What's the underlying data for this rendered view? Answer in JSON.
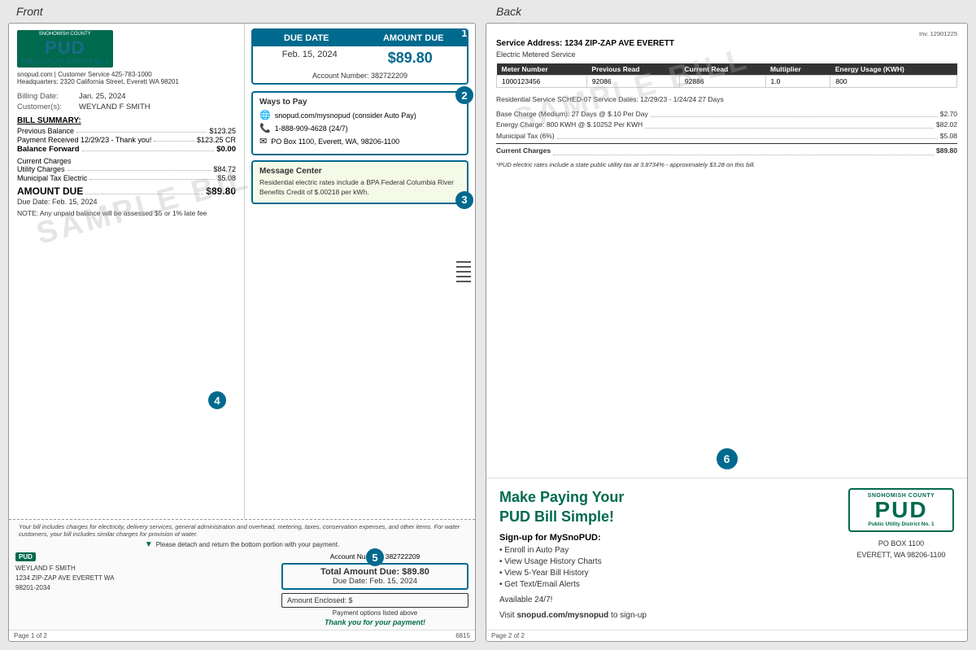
{
  "labels": {
    "front": "Front",
    "back": "Back"
  },
  "front": {
    "pud": {
      "county": "SNOHOMISH COUNTY",
      "name": "PUD",
      "subtitle": "PUBLIC UTILITY DISTRICT NO. 1",
      "contact": "snopud.com | Customer Service 425-783-1000",
      "headquarters": "Headquarters: 2320 California Street, Everett WA 98201"
    },
    "due_date_box": {
      "due_date_label": "DUE DATE",
      "amount_due_label": "AMOUNT DUE",
      "due_date_value": "Feb. 15, 2024",
      "amount_value": "$89.80",
      "account_label": "Account Number: 382722209",
      "badge": "1"
    },
    "billing": {
      "date_label": "Billing Date:",
      "date_value": "Jan. 25, 2024",
      "customer_label": "Customer(s):",
      "customer_value": "WEYLAND F SMITH",
      "summary_title": "BILL SUMMARY:",
      "previous_balance_label": "Previous Balance",
      "previous_balance_value": "$123.25",
      "payment_label": "Payment Received 12/29/23 - Thank you!",
      "payment_value": "$123.25 CR",
      "balance_label": "Balance Forward",
      "balance_value": "$0.00",
      "current_charges_title": "Current Charges",
      "utility_label": "Utility Charges",
      "utility_value": "$84.72",
      "tax_label": "Municipal Tax Electric",
      "tax_value": "$5.08",
      "amount_due_label": "AMOUNT DUE",
      "amount_due_value": "$89.80",
      "due_date": "Due Date: Feb. 15, 2024",
      "note": "NOTE:  Any unpaid balance will be assessed $5 or 1% late fee",
      "badge": "4"
    },
    "ways_to_pay": {
      "title": "Ways to Pay",
      "web": "snopud.com/mysnopud (consider Auto Pay)",
      "phone": "1-888-909-4628 (24/7)",
      "mail": "PO Box 1100, Everett, WA, 98206-1100",
      "badge": "2"
    },
    "message_center": {
      "title": "Message Center",
      "text": "Residential electric rates include a BPA Federal Columbia River Benefits Credit of $.00218 per kWh.",
      "badge": "3"
    },
    "sample_watermark": "SAMPLE BILL",
    "footer": {
      "detach_notice": "Please detach and return the bottom portion with your payment.",
      "footer_note": "Your bill includes charges for electricity, delivery services, general administration and overhead, metering, taxes, conservation expenses, and other items. For water customers, your bill includes similar charges for provision of water.",
      "account_number": "Account Number: 382722209",
      "total_amount": "Total Amount Due: $89.80",
      "due_date": "Due Date: Feb. 15, 2024",
      "enclosed_label": "Amount Enclosed: $",
      "payment_options": "Payment options listed above",
      "thank_you": "Thank you for your payment!",
      "address1": "WEYLAND F SMITH",
      "address2": "1234 ZIP-ZAP AVE EVERETT WA",
      "address3": "98201-2034",
      "badge": "5"
    },
    "page_number": "Page 1 of 2",
    "page_code": "6815"
  },
  "back": {
    "invoice_number": "Inv. 12901225",
    "service_address": "Service Address: 1234 ZIP-ZAP AVE     EVERETT",
    "electric_metered": "Electric Metered Service",
    "meter_table": {
      "headers": [
        "Meter Number",
        "Previous Read",
        "Current Read",
        "Multiplier",
        "Energy Usage  (KWH)"
      ],
      "row": [
        "1000123456",
        "92086",
        "92886",
        "1.0",
        "800"
      ]
    },
    "residential_service": "Residential Service    SCHED-07   Service Dates: 12/29/23 - 1/24/24   27 Days",
    "charges": [
      {
        "label": "Base Charge (Medium): 27 Days @ $.10 Per Day",
        "amount": "$2.70"
      },
      {
        "label": "Energy Charge: 800 KWH @ $.10252 Per KWH",
        "amount": "$82.02"
      },
      {
        "label": "Municipal Tax (6%)",
        "amount": "$5.08"
      }
    ],
    "current_charges_label": "Current Charges",
    "current_charges_amount": "$89.80",
    "tax_note": "*PUD electric rates include a state public utility tax at 3.8734% - approximately $3.28 on this bill.",
    "badge": "6",
    "watermark": "SAMPLE BILL",
    "make_paying": {
      "title_line1": "Make Paying Your",
      "title_line2": "PUD Bill Simple!",
      "signup_title": "Sign-up for MySnoPUD:",
      "items": [
        "Enroll in Auto Pay",
        "View Usage History Charts",
        "View 5-Year Bill History",
        "Get Text/Email Alerts"
      ],
      "available": "Available 24/7!",
      "visit_text": "Visit ",
      "visit_link": "snopud.com/mysnopud",
      "visit_suffix": " to sign-up"
    },
    "pud_logo": {
      "snohomish": "SNOHOMISH COUNTY",
      "name": "PUD",
      "district": "Public Utility District No. 1",
      "address1": "PO BOX 1100",
      "address2": "EVERETT, WA 98206-1100"
    },
    "page_number": "Page 2 of 2"
  }
}
